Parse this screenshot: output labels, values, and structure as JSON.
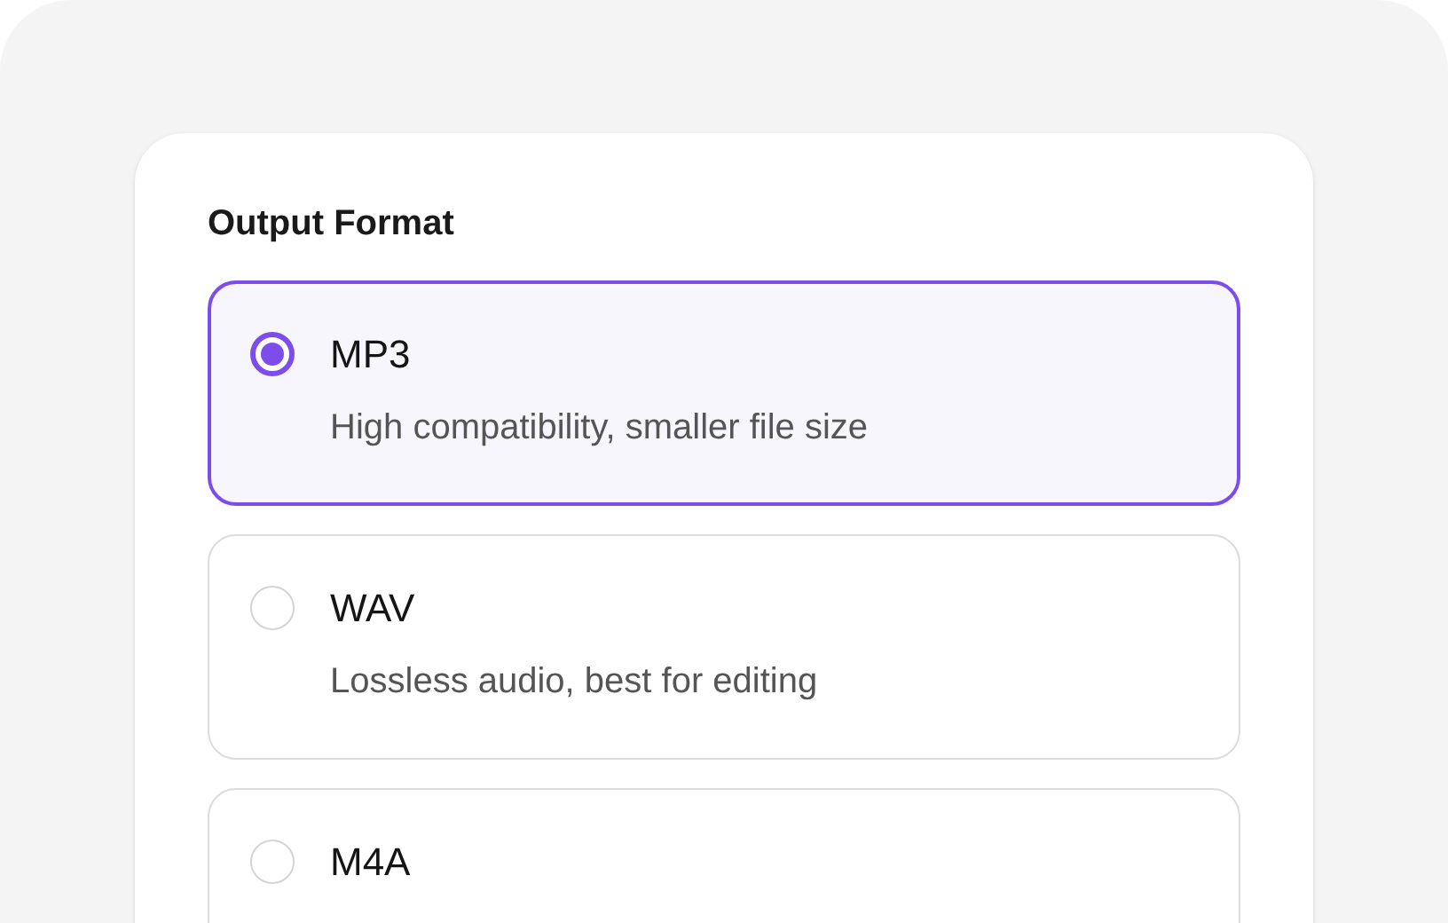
{
  "title": "Output Format",
  "options": [
    {
      "label": "MP3",
      "description": "High compatibility, smaller file size",
      "selected": true
    },
    {
      "label": "WAV",
      "description": "Lossless audio, best for editing",
      "selected": false
    },
    {
      "label": "M4A",
      "selected": false
    }
  ]
}
